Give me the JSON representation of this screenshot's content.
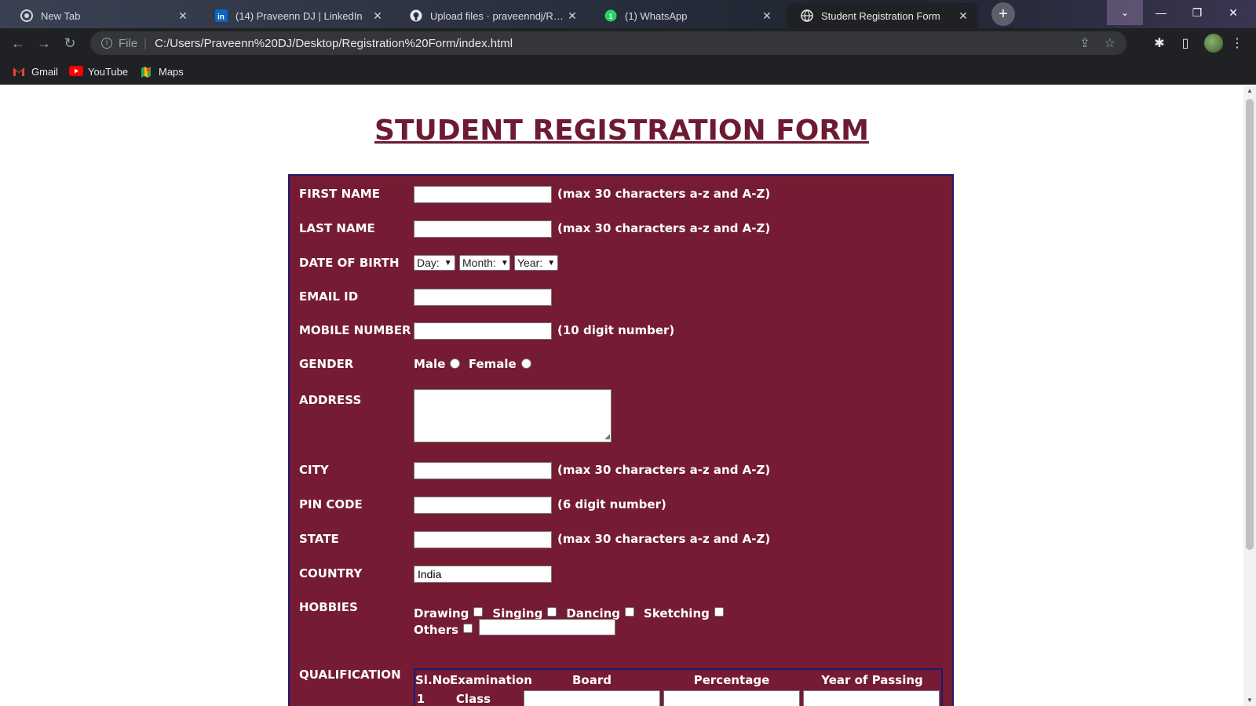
{
  "browser": {
    "tabs": [
      {
        "title": "New Tab",
        "icon": "chrome-icon",
        "active": false
      },
      {
        "title": "(14) Praveenn DJ | LinkedIn",
        "icon": "linkedin-icon",
        "active": false
      },
      {
        "title": "Upload files · praveenndj/Registr",
        "icon": "github-icon",
        "active": false
      },
      {
        "title": "(1) WhatsApp",
        "icon": "whatsapp-icon",
        "active": false
      },
      {
        "title": "Student Registration Form",
        "icon": "globe-icon",
        "active": true
      }
    ],
    "close_glyph": "✕",
    "new_tab_glyph": "+",
    "address": {
      "scheme": "File",
      "separator": "|",
      "url": "C:/Users/Praveenn%20DJ/Desktop/Registration%20Form/index.html"
    },
    "bookmarks": [
      {
        "label": "Gmail",
        "icon": "gmail-icon"
      },
      {
        "label": "YouTube",
        "icon": "youtube-icon"
      },
      {
        "label": "Maps",
        "icon": "maps-icon"
      }
    ]
  },
  "page": {
    "title": "STUDENT REGISTRATION FORM",
    "fields": {
      "first_name": {
        "label": "FIRST NAME",
        "value": "",
        "hint": "(max 30 characters a-z and A-Z)"
      },
      "last_name": {
        "label": "LAST NAME",
        "value": "",
        "hint": "(max 30 characters a-z and A-Z)"
      },
      "dob": {
        "label": "DATE OF BIRTH",
        "day": "Day:",
        "month": "Month:",
        "year": "Year:"
      },
      "email": {
        "label": "EMAIL ID",
        "value": ""
      },
      "mobile": {
        "label": "MOBILE NUMBER",
        "value": "",
        "hint": "(10 digit number)"
      },
      "gender": {
        "label": "GENDER",
        "options": [
          "Male",
          "Female"
        ]
      },
      "address": {
        "label": "ADDRESS",
        "value": ""
      },
      "city": {
        "label": "CITY",
        "value": "",
        "hint": "(max 30 characters a-z and A-Z)"
      },
      "pin": {
        "label": "PIN CODE",
        "value": "",
        "hint": "(6 digit number)"
      },
      "state": {
        "label": "STATE",
        "value": "",
        "hint": "(max 30 characters a-z and A-Z)"
      },
      "country": {
        "label": "COUNTRY",
        "value": "India"
      },
      "hobbies": {
        "label": "HOBBIES",
        "options": [
          "Drawing",
          "Singing",
          "Dancing",
          "Sketching",
          "Others"
        ]
      },
      "qualification": {
        "label": "QUALIFICATION",
        "headers": [
          "Sl.No.",
          "Examination",
          "Board",
          "Percentage",
          "Year of Passing"
        ],
        "rows": [
          {
            "sl": "1",
            "exam": "Class X"
          }
        ]
      }
    }
  },
  "colors": {
    "form_bg": "#751b33",
    "title": "#6d1a32",
    "border": "#1f1a6e"
  }
}
